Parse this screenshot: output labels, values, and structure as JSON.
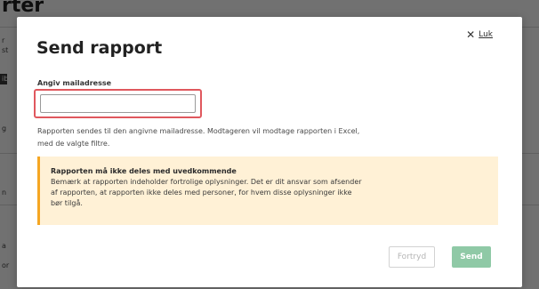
{
  "background": {
    "title_fragment": "rter",
    "side_fragments": [
      "r",
      "st",
      "ib",
      "g",
      "n",
      "a",
      "or"
    ]
  },
  "modal": {
    "title": "Send rapport",
    "close_label": "Luk",
    "close_icon": "close-icon",
    "email_label": "Angiv mailadresse",
    "email_value": "",
    "email_placeholder": "",
    "help_text": "Rapporten sendes til den angivne mailadresse. Modtageren vil modtage rapporten i Excel, med de valgte filtre.",
    "warning_title": "Rapporten må ikke deles med uvedkommende",
    "warning_body": "Bemærk at rapporten indeholder fortrolige oplysninger. Det er dit ansvar som afsender af rapporten, at rapporten ikke deles med personer, for hvem disse oplysninger ikke bør tilgå.",
    "cancel_label": "Fortryd",
    "send_label": "Send"
  },
  "colors": {
    "overlay": "#000000",
    "input_highlight": "#e0585e",
    "warning_bg": "#fff1d6",
    "warning_accent": "#f5a623",
    "send_button": "#8fc9a6"
  }
}
